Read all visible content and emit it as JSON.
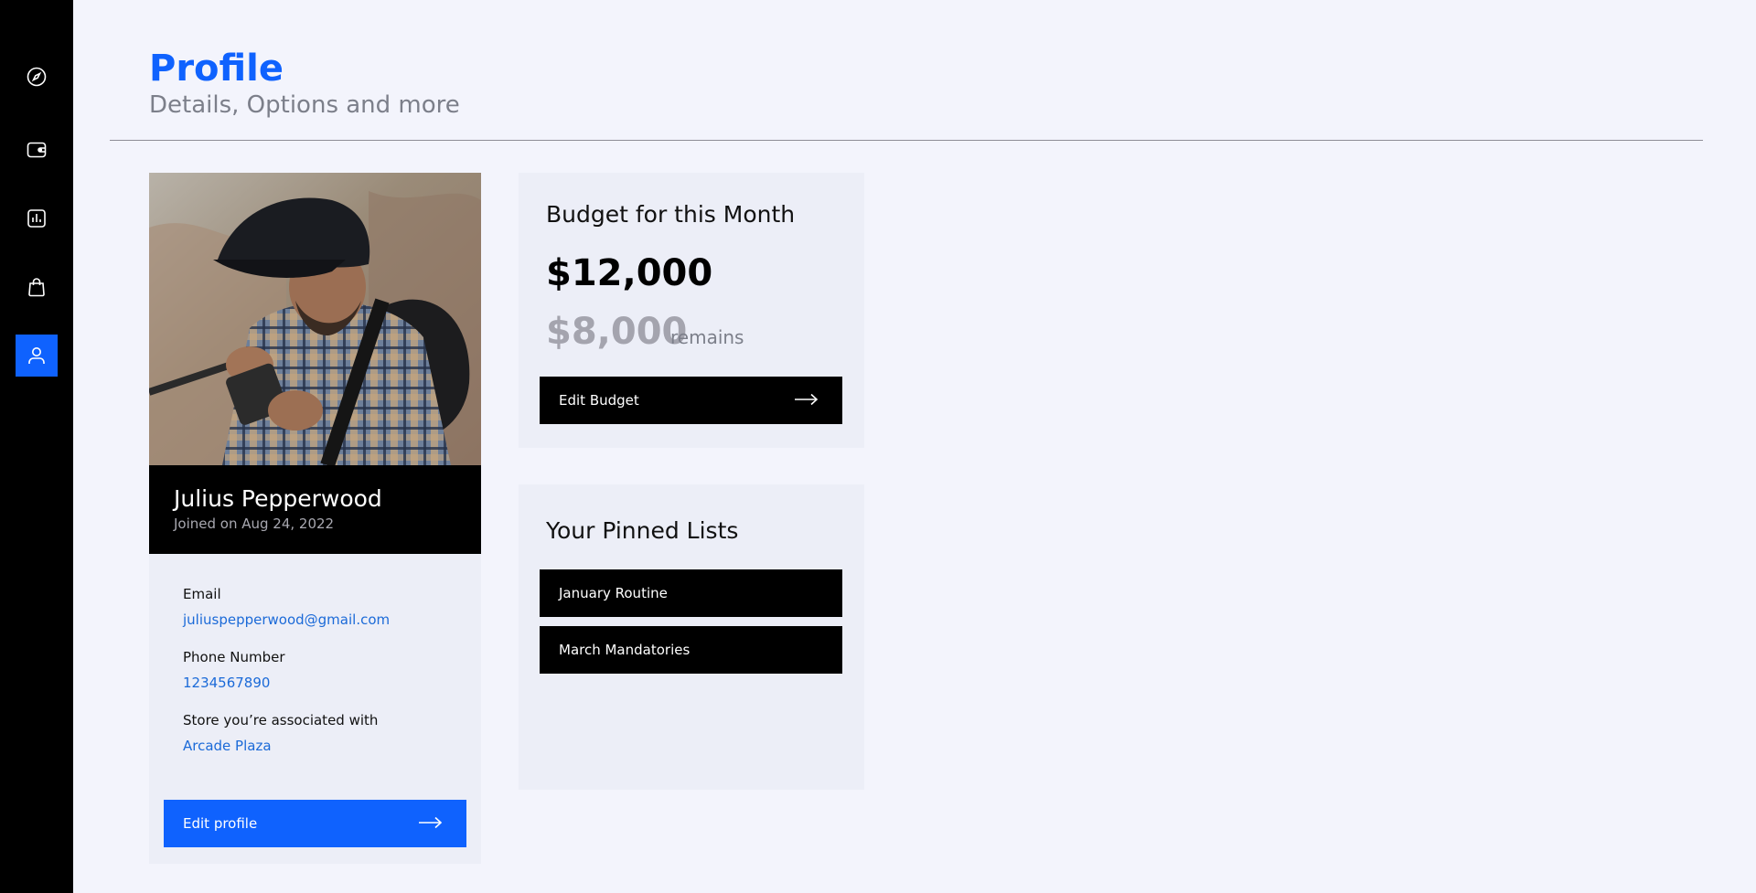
{
  "sidebar": {
    "items": [
      {
        "icon": "compass-icon",
        "active": false
      },
      {
        "icon": "wallet-icon",
        "active": false
      },
      {
        "icon": "report-icon",
        "active": false
      },
      {
        "icon": "shopping-bag-icon",
        "active": false
      },
      {
        "icon": "user-icon",
        "active": true
      }
    ]
  },
  "header": {
    "title": "Profile",
    "subtitle": "Details, Options and more"
  },
  "profile": {
    "name": "Julius Pepperwood",
    "joined": "Joined on Aug 24, 2022",
    "email_label": "Email",
    "email": "juliuspepperwood@gmail.com",
    "phone_label": "Phone Number",
    "phone": "1234567890",
    "store_label": "Store you’re associated with",
    "store": "Arcade Plaza",
    "edit_label": "Edit profile"
  },
  "budget": {
    "title": "Budget for this Month",
    "total": "$12,000",
    "remaining": "$8,000",
    "remaining_label": "remains",
    "edit_label": "Edit Budget"
  },
  "pinned": {
    "title": "Your Pinned Lists",
    "lists": [
      "January Routine",
      "March Mandatories"
    ]
  },
  "colors": {
    "accent": "#0f62fe",
    "sidebar": "#000000",
    "background": "#f3f4fc",
    "card": "#eceef7",
    "link": "#1b6ad8"
  }
}
